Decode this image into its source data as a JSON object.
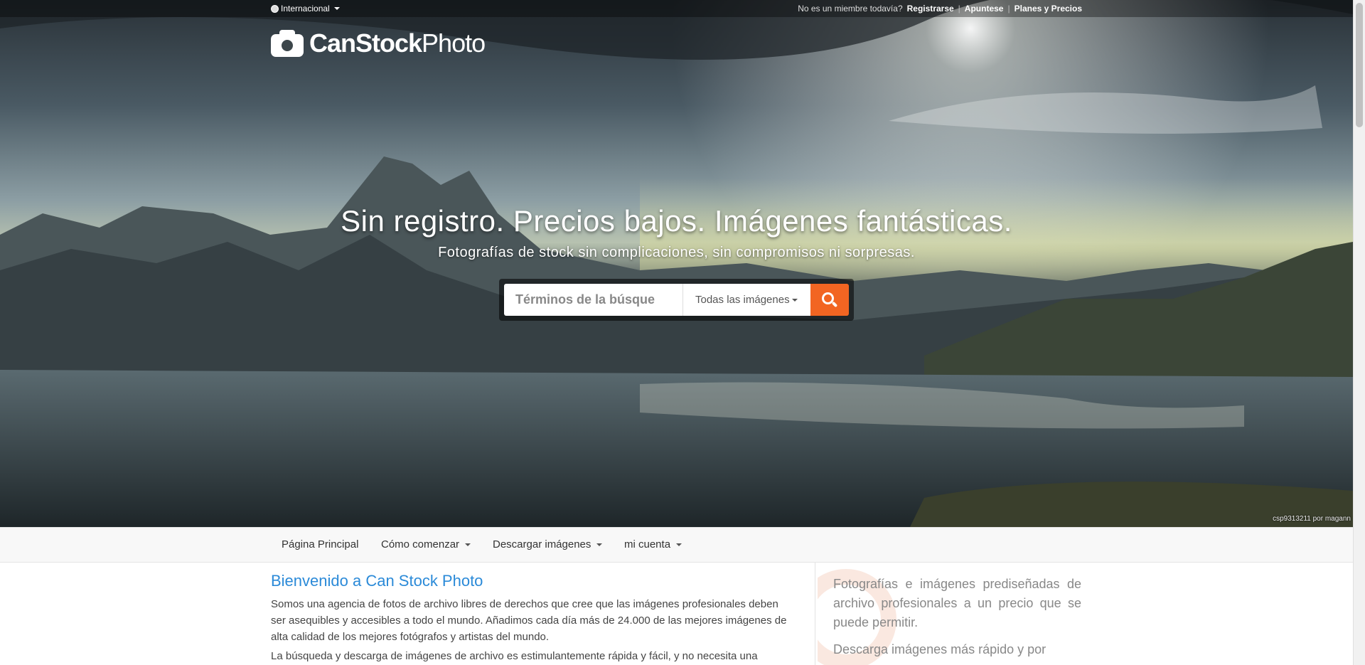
{
  "topbar": {
    "region_label": "Internacional",
    "region_icon": "globe-icon",
    "not_member_text": "No es un miembre todavía?",
    "register_link": "Registrarse",
    "signup_link": "Apuntese",
    "plans_link": "Planes y Precios",
    "separator": "|"
  },
  "logo": {
    "bold": "CanStock",
    "light": "Photo",
    "icon": "camera-icon"
  },
  "hero": {
    "headline": "Sin registro. Precios bajos. Imágenes fantásticas.",
    "subheadline": "Fotografías de stock sin complicaciones, sin compromisos ni sorpresas.",
    "credit": "csp9313211 por magann"
  },
  "search": {
    "placeholder": "Términos de la búsque",
    "category_selected": "Todas las imágenes",
    "button_icon": "search-icon",
    "button_color": "#f26522"
  },
  "nav": {
    "items": [
      {
        "label": "Página Principal",
        "dropdown": false
      },
      {
        "label": "Cómo comenzar",
        "dropdown": true
      },
      {
        "label": "Descargar imágenes",
        "dropdown": true
      },
      {
        "label": "mi cuenta",
        "dropdown": true
      }
    ]
  },
  "main": {
    "title": "Bienvenido a Can Stock Photo",
    "paragraph1": "Somos una agencia de fotos de archivo libres de derechos que cree que las imágenes profesionales deben ser asequibles y accesibles a todo el mundo. Añadimos cada día más de 24.000 de las mejores imágenes de alta calidad de los mejores fotógrafos y artistas del mundo.",
    "paragraph2": "La búsqueda y descarga de imágenes de archivo es estimulantemente rápida y fácil, y no necesita una"
  },
  "sidebar": {
    "text1": "Fotografías e imágenes prediseñadas de archivo profesionales a un precio que se puede permitir.",
    "text2": "Descarga imágenes más rápido y por"
  },
  "colors": {
    "link_blue": "#2b8ad8",
    "accent_orange": "#f26522"
  }
}
